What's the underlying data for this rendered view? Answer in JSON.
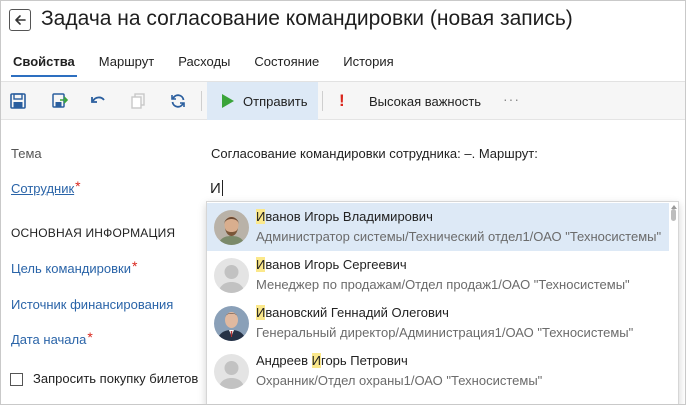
{
  "window": {
    "title": "Задача на согласование командировки (новая запись)"
  },
  "tabs": [
    {
      "label": "Свойства",
      "active": true
    },
    {
      "label": "Маршрут",
      "active": false
    },
    {
      "label": "Расходы",
      "active": false
    },
    {
      "label": "Состояние",
      "active": false
    },
    {
      "label": "История",
      "active": false
    }
  ],
  "toolbar": {
    "send_label": "Отправить",
    "priority_label": "Высокая важность",
    "more_label": "···"
  },
  "form": {
    "subject_label": "Тема",
    "subject_value": "Согласование командировки сотрудника:  –. Маршрут:",
    "employee_label": "Сотрудник",
    "employee_input_value": "И",
    "section_title": "ОСНОВНАЯ ИНФОРМАЦИЯ",
    "purpose_label": "Цель командировки",
    "funding_label": "Источник финансирования",
    "start_date_label": "Дата начала",
    "required_mark": "*",
    "request_tickets_label": "Запросить покупку билетов"
  },
  "suggestions": [
    {
      "name_pre": "",
      "name_hl": "И",
      "name_post": "ванов Игорь Владимирович",
      "desc": "Администратор системы/Технический отдел1/ОАО \"Техносистемы\"",
      "avatar": "photo-man-beard"
    },
    {
      "name_pre": "",
      "name_hl": "И",
      "name_post": "ванов Игорь Сергеевич",
      "desc": "Менеджер по продажам/Отдел продаж1/ОАО \"Техносистемы\"",
      "avatar": "placeholder"
    },
    {
      "name_pre": "",
      "name_hl": "И",
      "name_post": "вановский Геннадий Олегович",
      "desc": "Генеральный директор/Администрация1/ОАО \"Техносистемы\"",
      "avatar": "photo-man-suit"
    },
    {
      "name_pre": "Андреев ",
      "name_hl": "И",
      "name_post": "горь Петрович",
      "desc_pre": "Охранник/Отдел охраны1/ОАО \"Техносистемы\"",
      "desc": "Охранник/Отдел охраны1/ОАО \"Техносистемы\"",
      "avatar": "placeholder"
    }
  ],
  "colors": {
    "accent": "#2d6fc0",
    "link": "#2a64a8",
    "required": "#d9261c",
    "highlight": "#fbe88b",
    "selected_row": "#dde9f6",
    "send_icon": "#3aa43a"
  }
}
